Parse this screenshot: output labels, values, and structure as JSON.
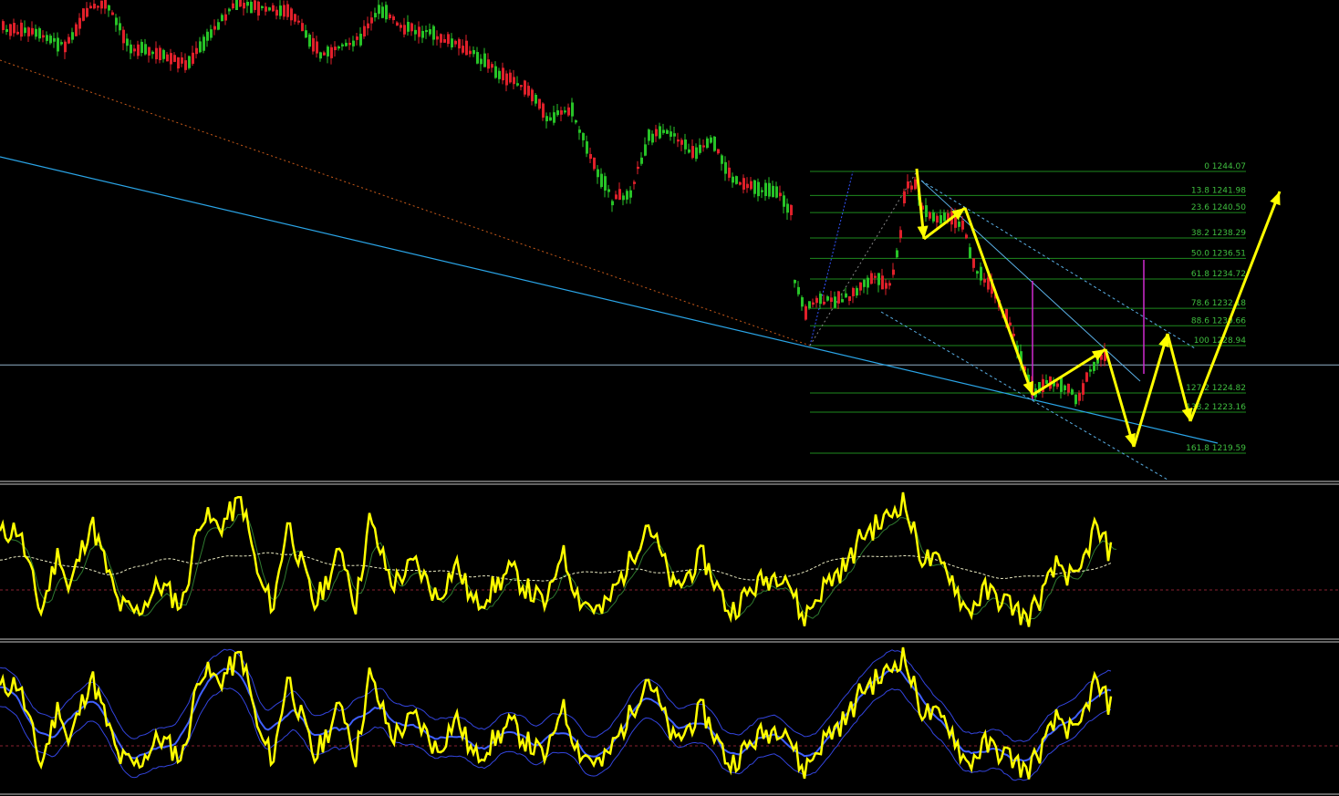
{
  "chart_data": {
    "type": "candlestick",
    "colors": {
      "background": "#000000",
      "bull": "#27c327",
      "bear": "#e0202a",
      "fib_line": "#1e8a1e",
      "fib_text": "#3fbf3f",
      "trend_blue": "#2aa4e6",
      "channel": "#5ab0e6",
      "orange_dotted": "#c85a1a",
      "forecast": "#ffff00",
      "magenta": "#d02ad0",
      "panel_border": "#c8c8c8",
      "osc_main": "#ffff00",
      "osc_ma": "#e8e8c0",
      "osc_signal": "#2f7a2f",
      "osc_band": "#3344dd",
      "level_line": "#8a2030"
    },
    "price_range": [
      1217.0,
      1263.0
    ],
    "horizontal_line_price": 1227.25,
    "fibonacci": {
      "levels": [
        {
          "label": "0 1244.07",
          "price": 1244.07
        },
        {
          "label": "13.8 1241.98",
          "price": 1241.98
        },
        {
          "label": "23.6 1240.50",
          "price": 1240.5
        },
        {
          "label": "38.2 1238.29",
          "price": 1238.29
        },
        {
          "label": "50.0 1236.51",
          "price": 1236.51
        },
        {
          "label": "61.8 1234.72",
          "price": 1234.72
        },
        {
          "label": "78.6 1232.18",
          "price": 1232.18
        },
        {
          "label": "88.6 1230.66",
          "price": 1230.66
        },
        {
          "label": "100 1228.94",
          "price": 1228.94
        },
        {
          "label": "127.2 1224.82",
          "price": 1224.82
        },
        {
          "label": "138.2 1223.16",
          "price": 1223.16
        },
        {
          "label": "161.8 1219.59",
          "price": 1219.59
        }
      ]
    },
    "oscillator_1": {
      "components": [
        "main",
        "signal",
        "average"
      ]
    },
    "oscillator_2": {
      "components": [
        "main",
        "average",
        "upper_band",
        "lower_band"
      ]
    }
  }
}
